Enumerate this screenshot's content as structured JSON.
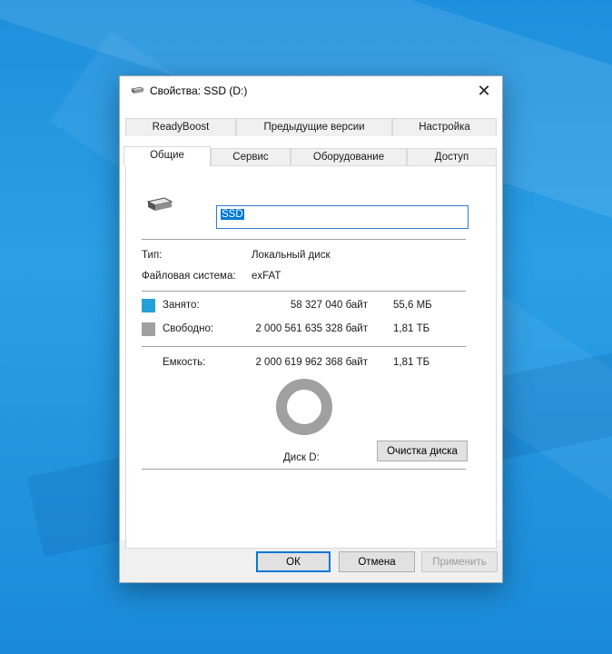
{
  "window": {
    "title": "Свойства: SSD (D:)",
    "close_glyph": "✕"
  },
  "tabs": {
    "row_back": [
      "ReadyBoost",
      "Предыдущие версии",
      "Настройка"
    ],
    "row_front": [
      "Общие",
      "Сервис",
      "Оборудование",
      "Доступ"
    ],
    "active": "Общие"
  },
  "general": {
    "drive_name": "SSD",
    "type_label": "Тип:",
    "type_value": "Локальный диск",
    "fs_label": "Файловая система:",
    "fs_value": "exFAT",
    "used_label": "Занято:",
    "used_bytes": "58 327 040 байт",
    "used_size": "55,6 МБ",
    "free_label": "Свободно:",
    "free_bytes": "2 000 561 635 328 байт",
    "free_size": "1,81 ТБ",
    "capacity_label": "Емкость:",
    "capacity_bytes": "2 000 619 962 368 байт",
    "capacity_size": "1,81 ТБ",
    "disk_label": "Диск D:",
    "cleanup_button": "Очистка диска",
    "used_fraction": 3e-05
  },
  "footer": {
    "ok": "ОК",
    "cancel": "Отмена",
    "apply": "Применить"
  },
  "colors": {
    "used": "#26a0da",
    "free": "#a0a0a0",
    "accent": "#0078d7"
  },
  "icons": {
    "title": "drive-icon",
    "drive": "drive-icon",
    "close": "close-icon"
  }
}
